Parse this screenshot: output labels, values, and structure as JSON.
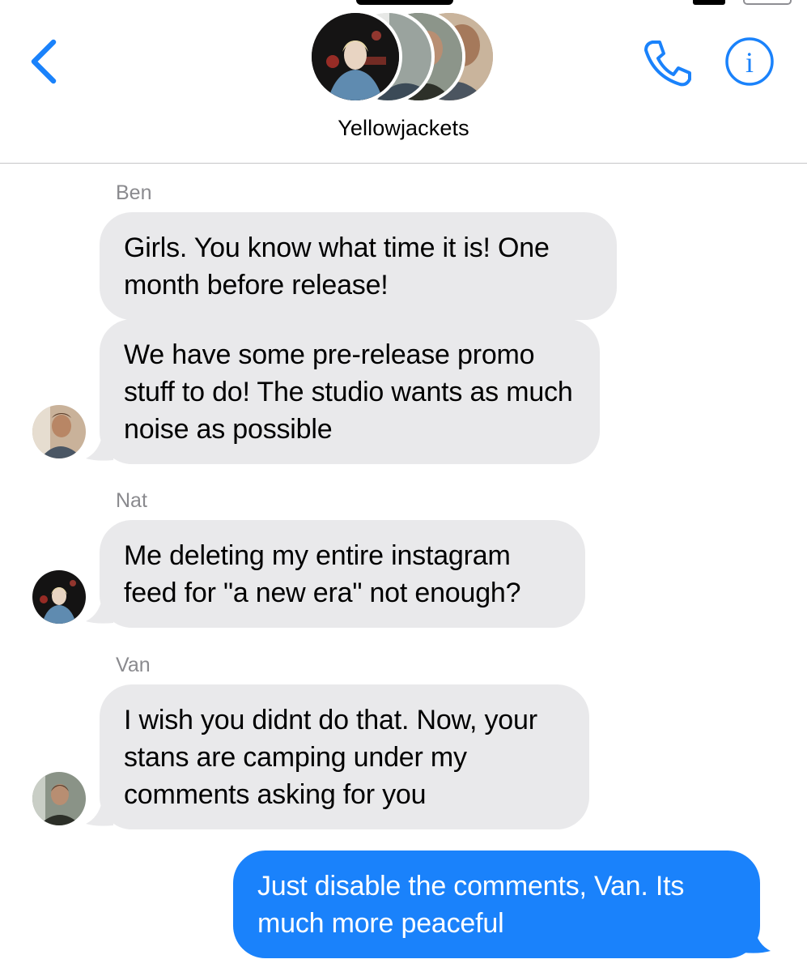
{
  "header": {
    "group_title": "Yellowjackets",
    "back_icon": "chevron-left-icon",
    "call_icon": "phone-icon",
    "info_icon": "info-icon",
    "accent_color": "#1a82fb"
  },
  "messages": [
    {
      "sender": "Ben",
      "text": "Girls. You know what time it is! One month before release!",
      "direction": "incoming"
    },
    {
      "sender": "Ben",
      "text": "We have some pre-release promo stuff to do! The studio wants as much noise as possible",
      "direction": "incoming"
    },
    {
      "sender": "Nat",
      "text": "Me deleting my entire instagram feed for \"a new era\" not enough?",
      "direction": "incoming"
    },
    {
      "sender": "Van",
      "text": "I wish you didnt do that. Now, your stans are camping under my comments asking for you",
      "direction": "incoming"
    },
    {
      "sender": "",
      "text": "Just disable the comments, Van. Its much more peaceful",
      "direction": "outgoing"
    }
  ],
  "colors": {
    "incoming_bubble": "#e9e9eb",
    "outgoing_bubble": "#1a82fb",
    "sender_name": "#8a8a8e"
  }
}
